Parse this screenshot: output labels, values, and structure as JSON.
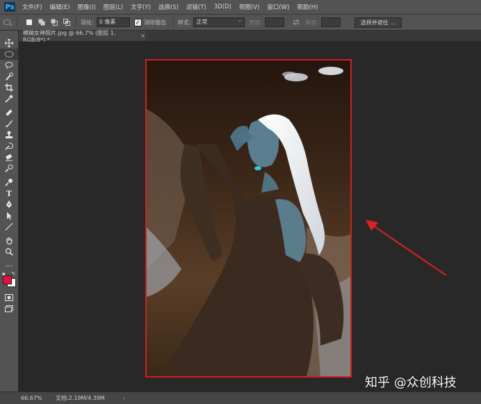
{
  "app": {
    "logo": "Ps"
  },
  "menubar": {
    "items": [
      "文件(F)",
      "编辑(E)",
      "图像(I)",
      "图层(L)",
      "文字(Y)",
      "选择(S)",
      "滤镜(T)",
      "3D(D)",
      "视图(V)",
      "窗口(W)",
      "帮助(H)"
    ]
  },
  "options": {
    "feather_label": "羽化:",
    "feather_value": "0 像素",
    "antialias_label": "消除锯齿",
    "style_label": "样式:",
    "style_value": "正常",
    "width_label": "宽度:",
    "height_label": "高度:",
    "select_mask_button": "选择并遮住 ..."
  },
  "tools": [
    "move-tool-icon",
    "elliptical-marquee-tool-icon",
    "lasso-tool-icon",
    "quick-selection-tool-icon",
    "crop-tool-icon",
    "eyedropper-tool-icon",
    "healing-brush-tool-icon",
    "brush-tool-icon",
    "clone-stamp-tool-icon",
    "history-brush-tool-icon",
    "eraser-tool-icon",
    "gradient-tool-icon",
    "dodge-tool-icon",
    "pen-tool-icon",
    "type-tool-icon",
    "path-selection-tool-icon",
    "line-tool-icon",
    "hand-tool-icon",
    "zoom-tool-icon",
    "more-tools-icon"
  ],
  "colors": {
    "foreground": "#e8103a",
    "background": "#ffffff",
    "selection_border": "#d31f1f",
    "annotation_arrow": "#e02020"
  },
  "document": {
    "tab_title": "模糊女神照片.jpg @ 66.7% (图层 1, RGB/8*) *",
    "tab_close": "×"
  },
  "status": {
    "zoom": "66.67%",
    "doc_info": "文档:2.19M/4.39M",
    "arrow": "›"
  },
  "watermark": {
    "text": "知乎 @众创科技"
  }
}
